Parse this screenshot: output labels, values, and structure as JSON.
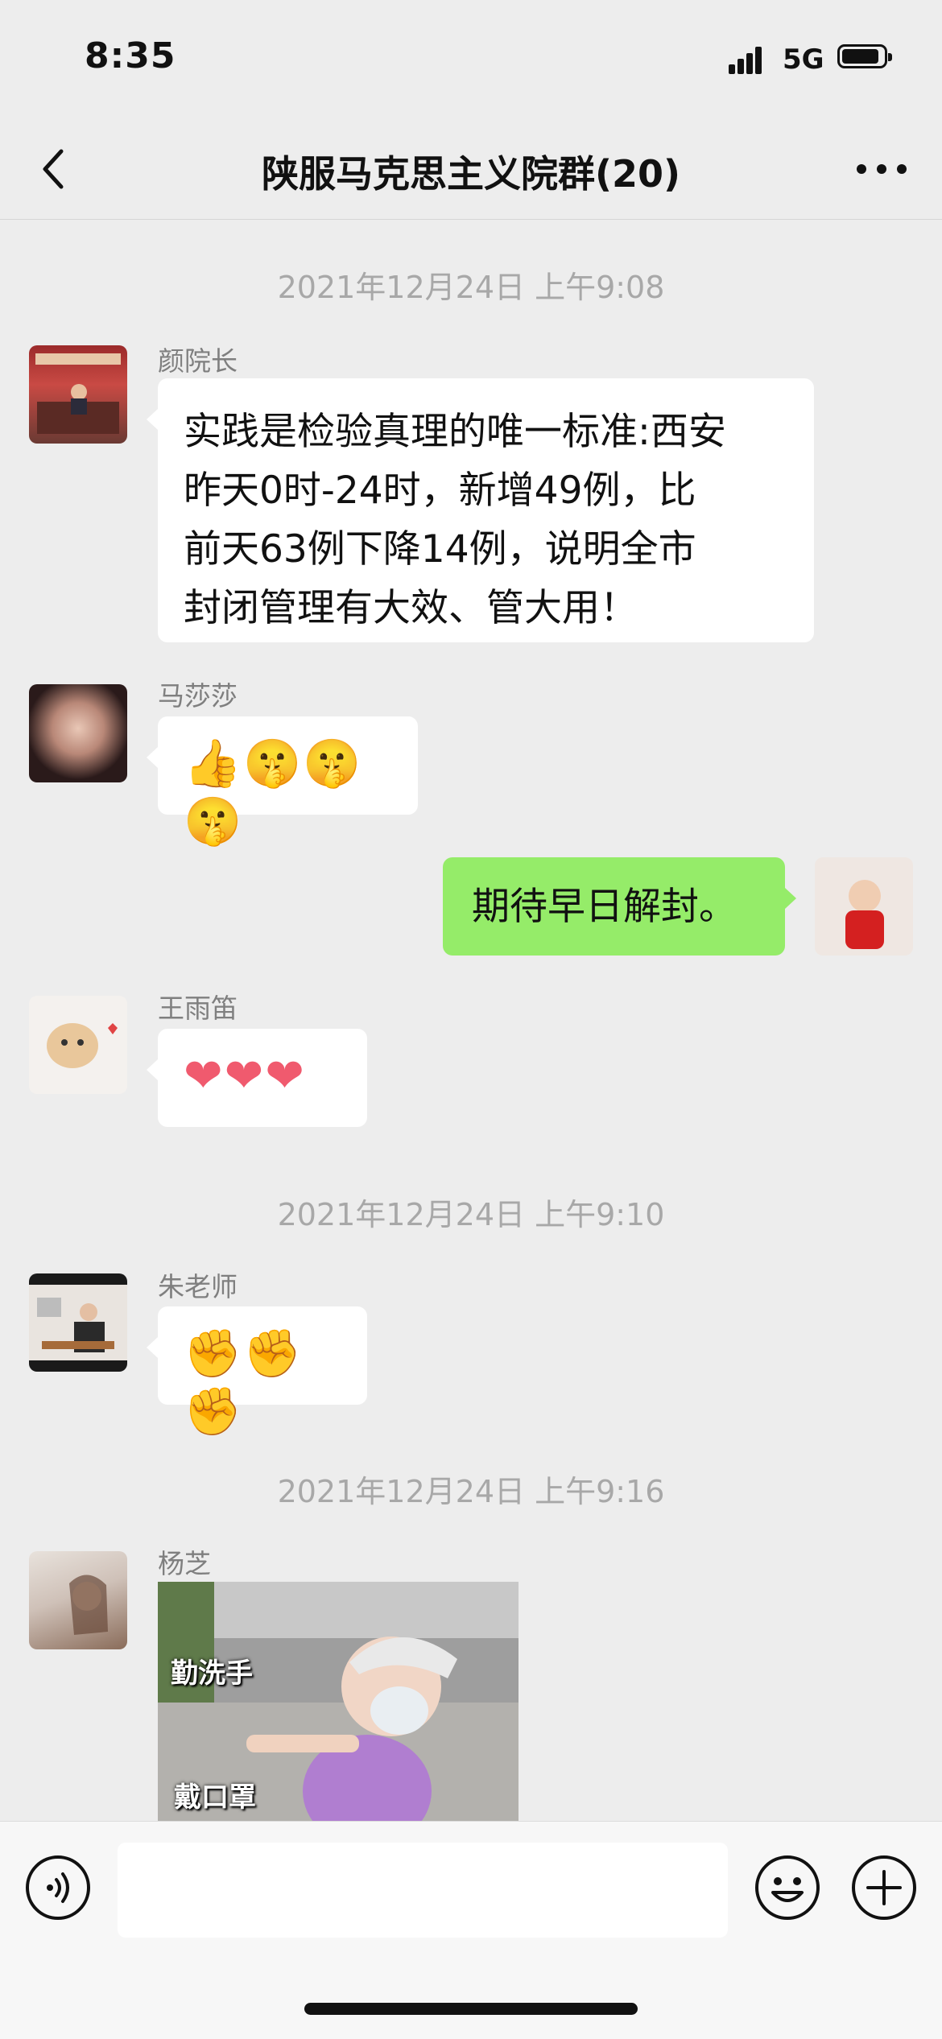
{
  "status_bar": {
    "time": "8:35",
    "network": "5G"
  },
  "header": {
    "title": "陕服马克思主义院群(20)"
  },
  "messages": [
    {
      "type": "timestamp",
      "text": "2021年12月24日 上午9:08"
    },
    {
      "type": "text",
      "sender": "颜院长",
      "text": "实践是检验真理的唯一标准:西安\n昨天0时-24时，新增49例，比\n前天63例下降14例，说明全市\n封闭管理有大效、管大用！"
    },
    {
      "type": "emoji",
      "sender": "马莎莎",
      "text": "👍🤫🤫🤫"
    },
    {
      "type": "text",
      "sender": "me",
      "text": "期待早日解封。"
    },
    {
      "type": "emoji",
      "sender": "王雨笛",
      "text": "❤❤❤"
    },
    {
      "type": "timestamp",
      "text": "2021年12月24日 上午9:10"
    },
    {
      "type": "emoji",
      "sender": "朱老师",
      "text": "✊✊✊"
    },
    {
      "type": "timestamp",
      "text": "2021年12月24日 上午9:16"
    },
    {
      "type": "image",
      "sender": "杨芝",
      "captions": [
        "勤洗手",
        "戴口罩"
      ]
    }
  ],
  "input": {
    "placeholder": ""
  },
  "colors": {
    "background": "#ededed",
    "self_bubble": "#95ec69",
    "other_bubble": "#ffffff",
    "timestamp": "#a8a8a8"
  }
}
